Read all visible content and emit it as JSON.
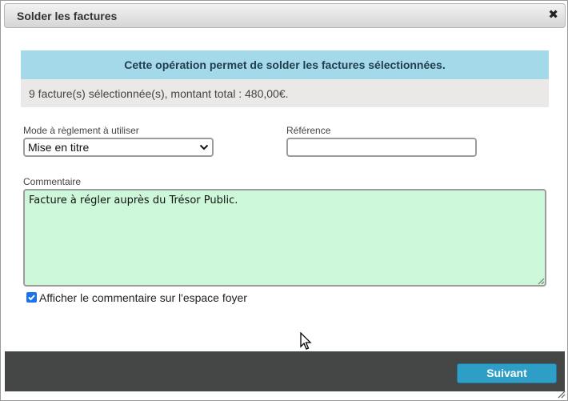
{
  "dialog": {
    "title": "Solder les factures",
    "close_icon": "close-icon",
    "close_glyph": "✖"
  },
  "banner": {
    "text": "Cette opération permet de solder les factures sélectionnées."
  },
  "summary": {
    "text": "9 facture(s) sélectionnée(s), montant total : 480,00€."
  },
  "form": {
    "mode_label": "Mode à règlement à utiliser",
    "mode_value": "Mise en titre",
    "reference_label": "Référence",
    "reference_value": "",
    "comment_label": "Commentaire",
    "comment_value": "Facture à régler auprès du Trésor Public.",
    "show_comment_label": "Afficher le commentaire sur l'espace foyer",
    "show_comment_checked": true
  },
  "footer": {
    "next_label": "Suivant"
  },
  "colors": {
    "banner_bg": "#a4d9ea",
    "summary_bg": "#ebe9e7",
    "comment_bg": "#ccf8d9",
    "footer_bg": "#444646",
    "button_bg": "#2e9ec7",
    "checkbox_accent": "#1a73e8"
  },
  "icons": {
    "select_arrow": "chevron-down-icon",
    "checkbox_mark": "checkmark-icon",
    "pointer": "mouse-pointer-icon",
    "resize": "resize-grip-icon"
  }
}
